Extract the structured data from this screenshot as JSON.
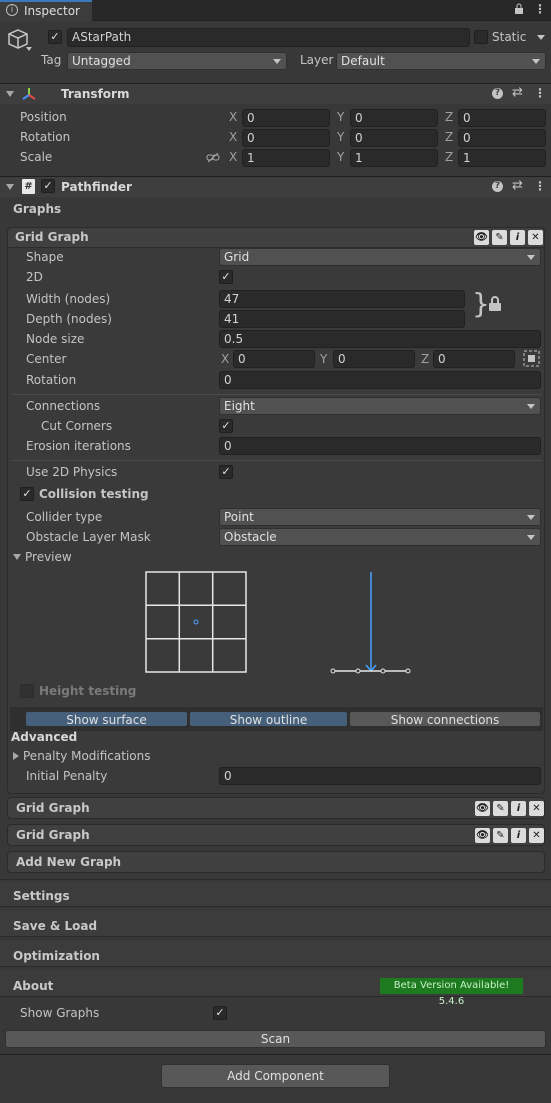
{
  "tab": {
    "title": "Inspector"
  },
  "object": {
    "name": "AStarPath",
    "static_label": "Static",
    "tag_label": "Tag",
    "tag_value": "Untagged",
    "layer_label": "Layer",
    "layer_value": "Default"
  },
  "transform": {
    "title": "Transform",
    "position_label": "Position",
    "rotation_label": "Rotation",
    "scale_label": "Scale",
    "x": "X",
    "y": "Y",
    "z": "Z",
    "position": [
      "0",
      "0",
      "0"
    ],
    "rotation": [
      "0",
      "0",
      "0"
    ],
    "scale": [
      "1",
      "1",
      "1"
    ]
  },
  "pathfinder": {
    "title": "Pathfinder",
    "graphs_label": "Graphs",
    "grid_graph_title": "Grid Graph",
    "shape_label": "Shape",
    "shape_value": "Grid",
    "twod_label": "2D",
    "width_label": "Width (nodes)",
    "width_value": "47",
    "depth_label": "Depth (nodes)",
    "depth_value": "41",
    "nodesize_label": "Node size",
    "nodesize_value": "0.5",
    "center_label": "Center",
    "center": [
      "0",
      "0",
      "0"
    ],
    "rotation_label": "Rotation",
    "rotation_value": "0",
    "connections_label": "Connections",
    "connections_value": "Eight",
    "cutcorners_label": "Cut Corners",
    "erosion_label": "Erosion iterations",
    "erosion_value": "0",
    "use2d_label": "Use 2D Physics",
    "collision_label": "Collision testing",
    "collider_label": "Collider type",
    "collider_value": "Point",
    "mask_label": "Obstacle Layer Mask",
    "mask_value": "Obstacle",
    "preview_label": "Preview",
    "height_label": "Height testing",
    "show_surface": "Show surface",
    "show_outline": "Show outline",
    "show_connections": "Show connections",
    "advanced_label": "Advanced",
    "penalty_mod_label": "Penalty Modifications",
    "initial_penalty_label": "Initial Penalty",
    "initial_penalty_value": "0",
    "grid_graph_2": "Grid Graph",
    "grid_graph_3": "Grid Graph",
    "add_graph": "Add New Graph",
    "settings": "Settings",
    "save_load": "Save & Load",
    "optimization": "Optimization",
    "about": "About",
    "beta_badge": "Beta Version Available! 5.4.6",
    "show_graphs": "Show Graphs",
    "scan": "Scan"
  },
  "add_component": "Add Component",
  "colors": {
    "accent_blue": "#4aa3ff",
    "badge_green": "#1e7a1e",
    "selected_toggle": "#46607c"
  }
}
